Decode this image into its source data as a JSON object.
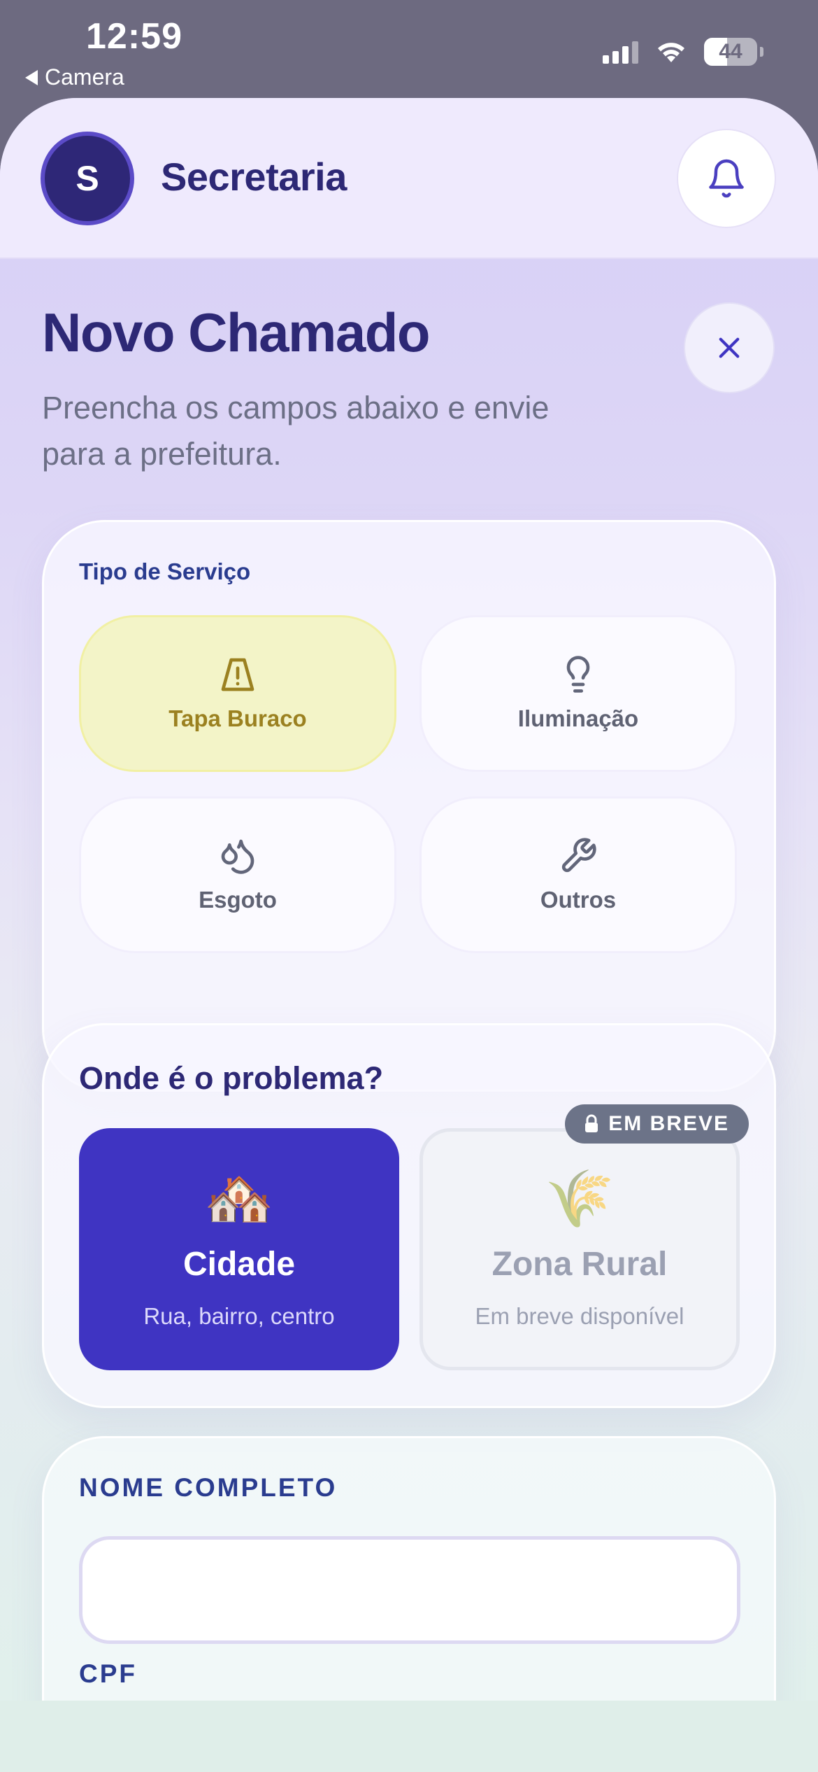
{
  "status_bar": {
    "time": "12:59",
    "back_app": "Camera",
    "battery_level": "44",
    "signal_bars_active": 3,
    "signal_bars_total": 4
  },
  "header": {
    "avatar_initial": "S",
    "brand": "Secretaria",
    "bell_icon": "bell-icon"
  },
  "page": {
    "title": "Novo Chamado",
    "subtitle": "Preencha os campos abaixo e envie para a prefeitura.",
    "close_icon": "close-icon"
  },
  "service": {
    "label": "Tipo de Serviço",
    "options": [
      {
        "label": "Tapa Buraco",
        "icon": "road-warning-icon",
        "selected": true
      },
      {
        "label": "Iluminação",
        "icon": "lightbulb-icon",
        "selected": false
      },
      {
        "label": "Esgoto",
        "icon": "droplets-icon",
        "selected": false
      },
      {
        "label": "Outros",
        "icon": "wrench-icon",
        "selected": false
      }
    ]
  },
  "location": {
    "title": "Onde é o problema?",
    "city": {
      "emoji": "🏘️",
      "name": "Cidade",
      "desc": "Rua, bairro, centro",
      "selected": true
    },
    "rural": {
      "emoji": "🌾",
      "name": "Zona Rural",
      "desc": "Em breve disponível",
      "badge": "EM BREVE",
      "disabled": true
    }
  },
  "form": {
    "name_label": "NOME COMPLETO",
    "name_value": "",
    "cpf_label": "CPF"
  },
  "colors": {
    "primary": "#3f34c2",
    "navy": "#2d2875",
    "selected_service_bg": "#f3f4c8",
    "selected_service_text": "#9b8120",
    "badge_bg": "#6c7388"
  }
}
